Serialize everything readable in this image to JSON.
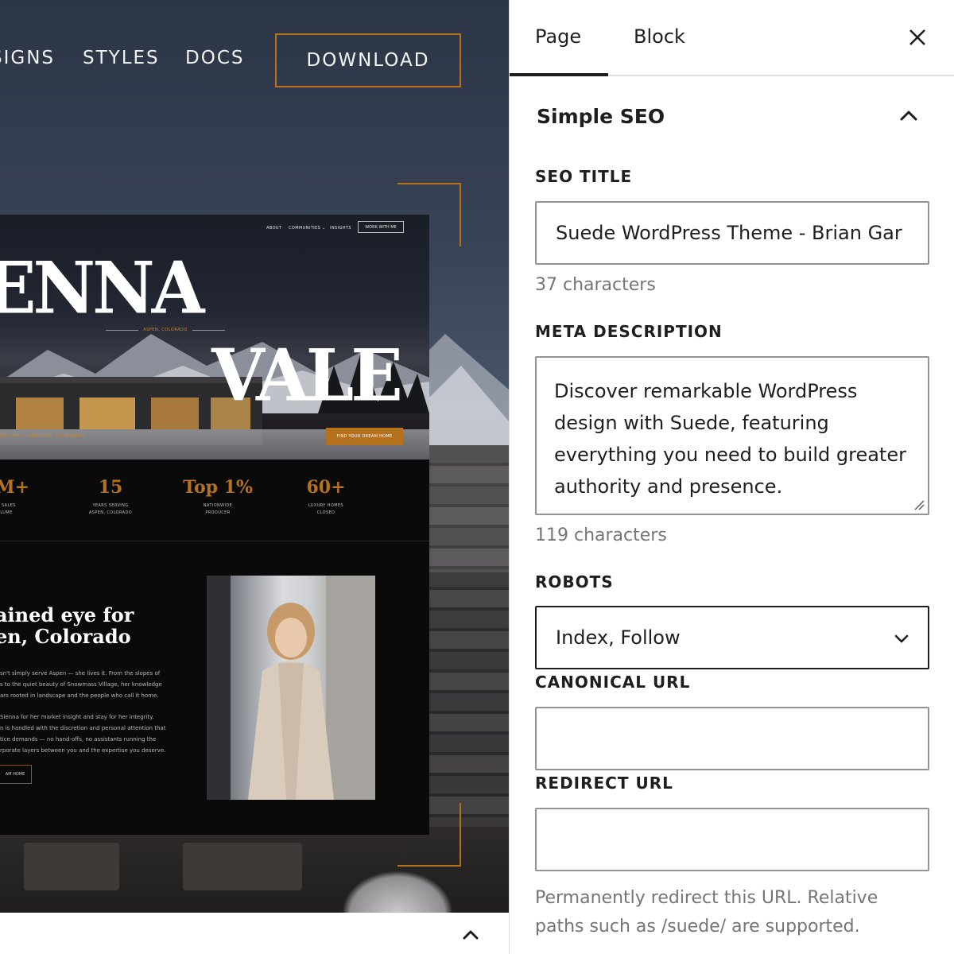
{
  "canvas": {
    "nav": {
      "designs_label": "SIGNS",
      "styles_label": "STYLES",
      "docs_label": "DOCS",
      "download_label": "DOWNLOAD"
    },
    "preview": {
      "mini_nav": [
        "ABOUT",
        "COMMUNITIES ⌄",
        "INSIGHTS"
      ],
      "work_button": "WORK WITH ME",
      "word_one": "ENNA",
      "word_two": "VALE",
      "location": "ASPEN, COLORADO",
      "hero_links": "HIGHLANDS · SNOWMASS · RED MOUNTAIN",
      "cta_button": "FIND YOUR DREAM HOME",
      "stats": [
        {
          "value": "5M+",
          "label_line1": "R SALES",
          "label_line2": "LUME"
        },
        {
          "value": "15",
          "label_line1": "YEARS SERVING",
          "label_line2": "ASPEN, COLORADO"
        },
        {
          "value": "Top 1%",
          "label_line1": "NATIONWIDE",
          "label_line2": "PRODUCER"
        },
        {
          "value": "60+",
          "label_line1": "LUXURY HOMES",
          "label_line2": "CLOSED"
        }
      ],
      "about_heading_line1": "ained eye for",
      "about_heading_line2": "en, Colorado",
      "about_para1": [
        "sn't simply serve Aspen — she lives it. From the slopes of",
        "s to the quiet beauty of Snowmass Village, her knowledge",
        "ars rooted in landscape and the people who call it home."
      ],
      "about_para2": [
        "Sienna for her market insight and stay for her integrity.",
        "n is handled with the discretion and personal attention that",
        "tice demands — no hand-offs, no assistants running the",
        "rporate layers between you and the expertise you deserve."
      ],
      "about_button": "AM HOME"
    }
  },
  "sidebar": {
    "tabs": {
      "page": "Page",
      "block": "Block"
    },
    "panel_title": "Simple SEO",
    "seo_title": {
      "label": "SEO TITLE",
      "value": "Suede WordPress Theme - Brian Gar",
      "count": "37 characters"
    },
    "meta_description": {
      "label": "META DESCRIPTION",
      "lines": [
        "Discover remarkable WordPress",
        "design with Suede, featuring",
        "everything you need to build greater",
        "authority and presence."
      ],
      "count": "119 characters"
    },
    "robots": {
      "label": "ROBOTS",
      "selected": "Index, Follow"
    },
    "canonical_url": {
      "label": "CANONICAL URL",
      "value": ""
    },
    "redirect_url": {
      "label": "REDIRECT URL",
      "value": "",
      "help_line1": "Permanently redirect this URL. Relative",
      "help_line2": "paths such as /suede/ are supported."
    }
  },
  "colors": {
    "accent_gold": "#b5721e",
    "text_dark": "#1e1e1e",
    "text_muted": "#757575",
    "input_border": "#949494"
  }
}
